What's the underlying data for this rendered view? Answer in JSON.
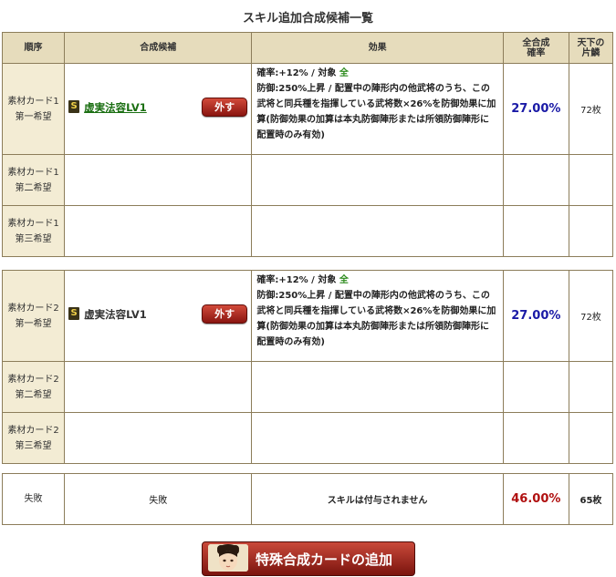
{
  "title": "スキル追加合成候補一覧",
  "headers": {
    "order": "順序",
    "candidate": "合成候補",
    "effect": "効果",
    "rate_line1": "全合成",
    "rate_line2": "確率",
    "count_line1": "天下の",
    "count_line2": "片鱗"
  },
  "group1": {
    "row1": {
      "order_line1": "素材カード1",
      "order_line2": "第一希望",
      "badge": "S",
      "skill": "虚実法容LV1",
      "remove_label": "外す",
      "effect_rate": "確率:+12% / 対象 ",
      "effect_target": "全",
      "effect_body": "防御:250%上昇 / 配置中の陣形内の他武将のうち、この武将と同兵種を指揮している武将数×26%を防御効果に加算(防御効果の加算は本丸防御陣形または所領防御陣形に配置時のみ有効)",
      "rate": "27.00%",
      "count": "72枚"
    },
    "row2": {
      "order_line1": "素材カード1",
      "order_line2": "第二希望"
    },
    "row3": {
      "order_line1": "素材カード1",
      "order_line2": "第三希望"
    }
  },
  "group2": {
    "row1": {
      "order_line1": "素材カード2",
      "order_line2": "第一希望",
      "badge": "S",
      "skill": "虚実法容LV1",
      "remove_label": "外す",
      "effect_rate": "確率:+12% / 対象 ",
      "effect_target": "全",
      "effect_body": "防御:250%上昇 / 配置中の陣形内の他武将のうち、この武将と同兵種を指揮している武将数×26%を防御効果に加算(防御効果の加算は本丸防御陣形または所領防御陣形に配置時のみ有効)",
      "rate": "27.00%",
      "count": "72枚"
    },
    "row2": {
      "order_line1": "素材カード2",
      "order_line2": "第二希望"
    },
    "row3": {
      "order_line1": "素材カード2",
      "order_line2": "第三希望"
    }
  },
  "failure": {
    "order": "失敗",
    "candidate": "失敗",
    "effect": "スキルは付与されません",
    "rate": "46.00%",
    "count": "65枚"
  },
  "special_button": "特殊合成カードの追加",
  "colors": {
    "rate_blue": "#1a1aa6",
    "rate_red": "#b01010",
    "target_green": "#2c8b1c",
    "header_bg": "#e6dcbc",
    "order_bg": "#f3ecd4"
  }
}
